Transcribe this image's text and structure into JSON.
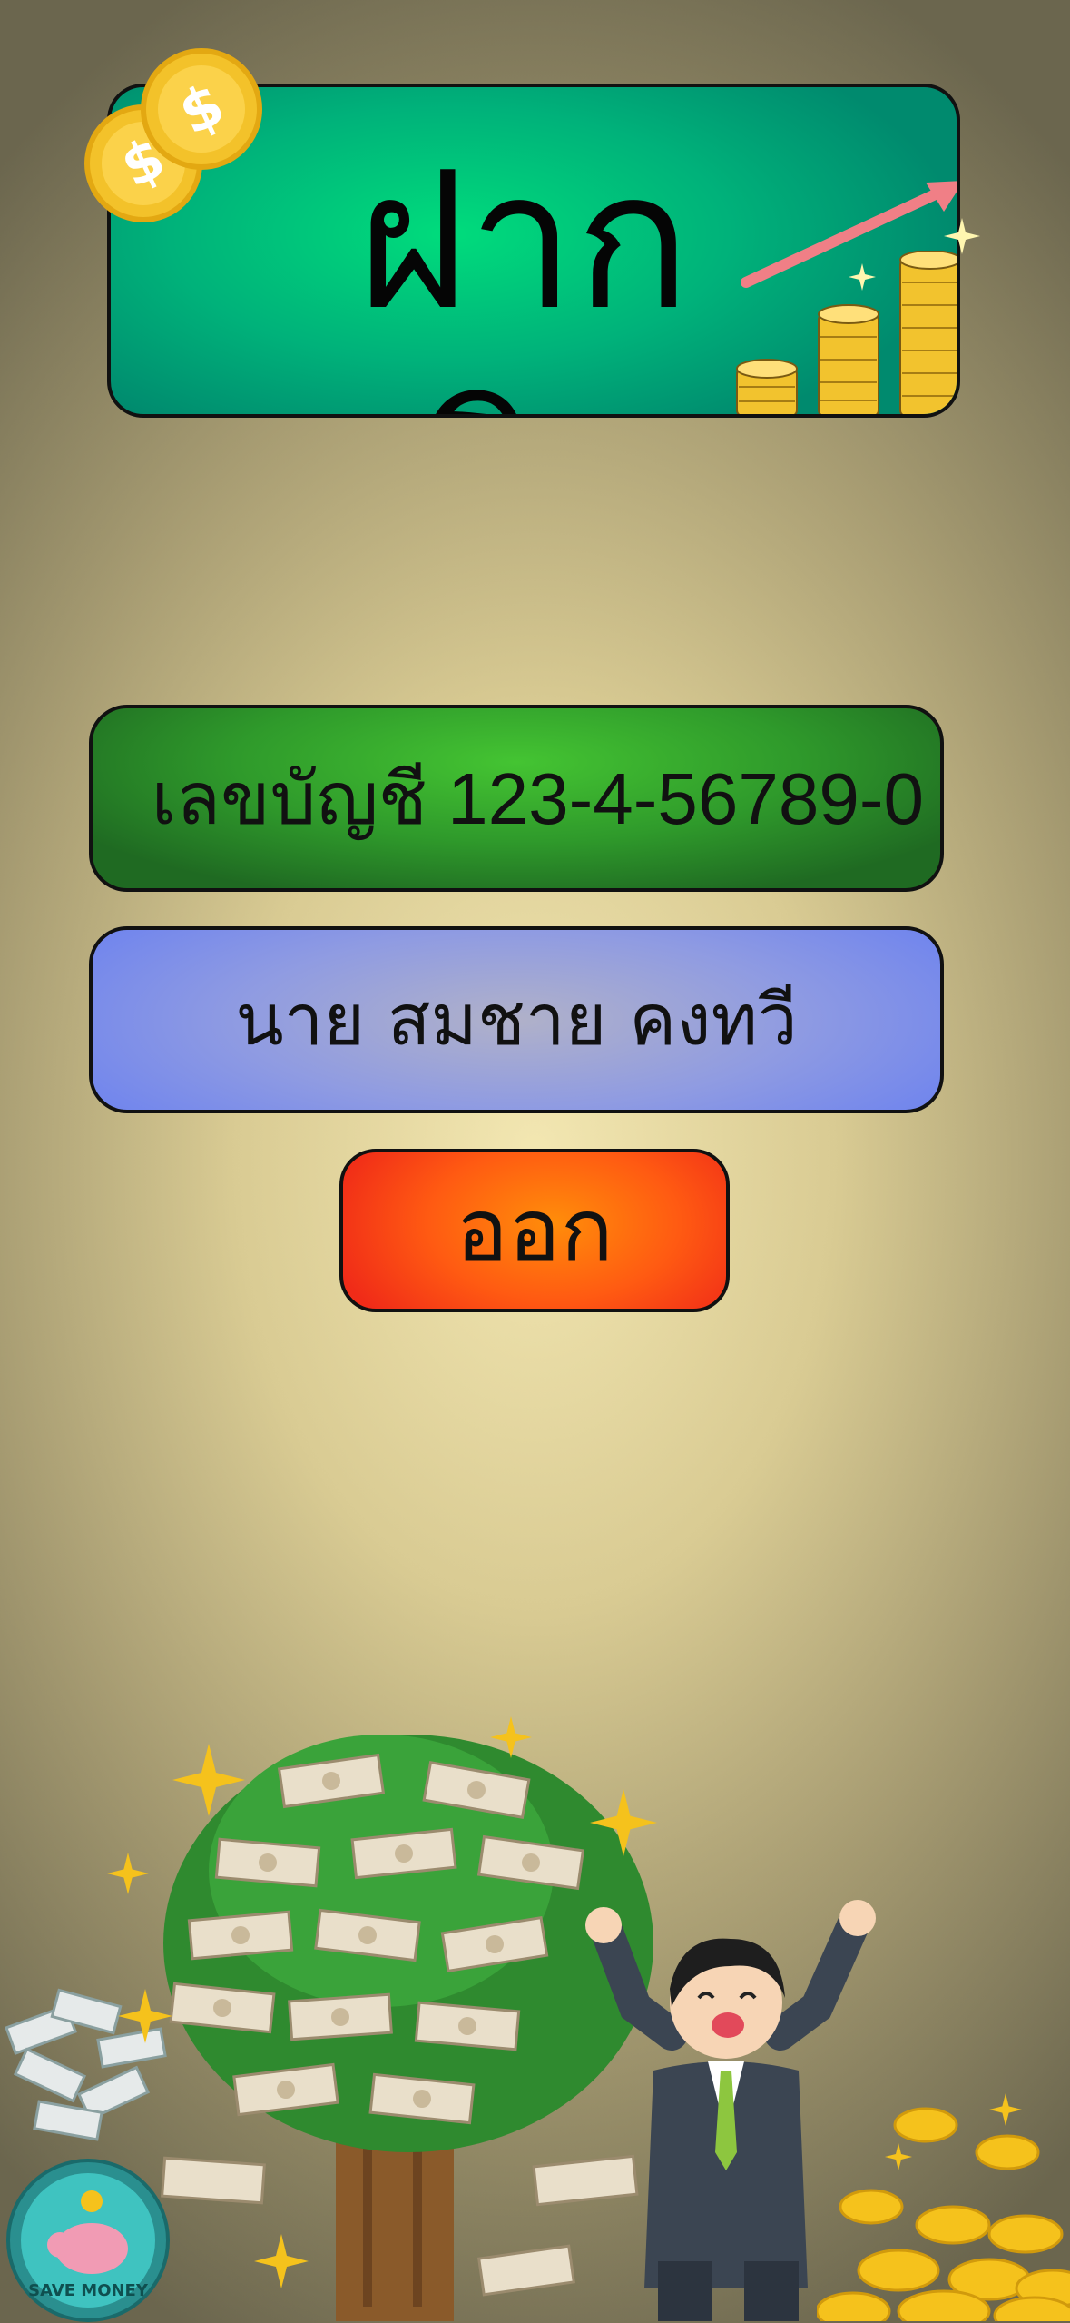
{
  "banner": {
    "title": "ฝากเงิน"
  },
  "account": {
    "label": "เลขบัญชี 123-4-56789-0"
  },
  "holder": {
    "name": "นาย สมชาย คงทวี"
  },
  "actions": {
    "exit_label": "ออก"
  },
  "badge": {
    "text": "SAVE MONEY"
  },
  "colors": {
    "banner_green": "#00c27a",
    "account_green": "#3aaa2c",
    "name_blue": "#7c8ee8",
    "exit_orange": "#ff6a10"
  },
  "icons": [
    "dollar-coin-icon",
    "growth-arrow-icon",
    "coin-stack-icon",
    "money-tree-icon",
    "happy-businessman-icon",
    "piggy-bank-icon",
    "gold-coins-icon",
    "sparkle-icon"
  ]
}
